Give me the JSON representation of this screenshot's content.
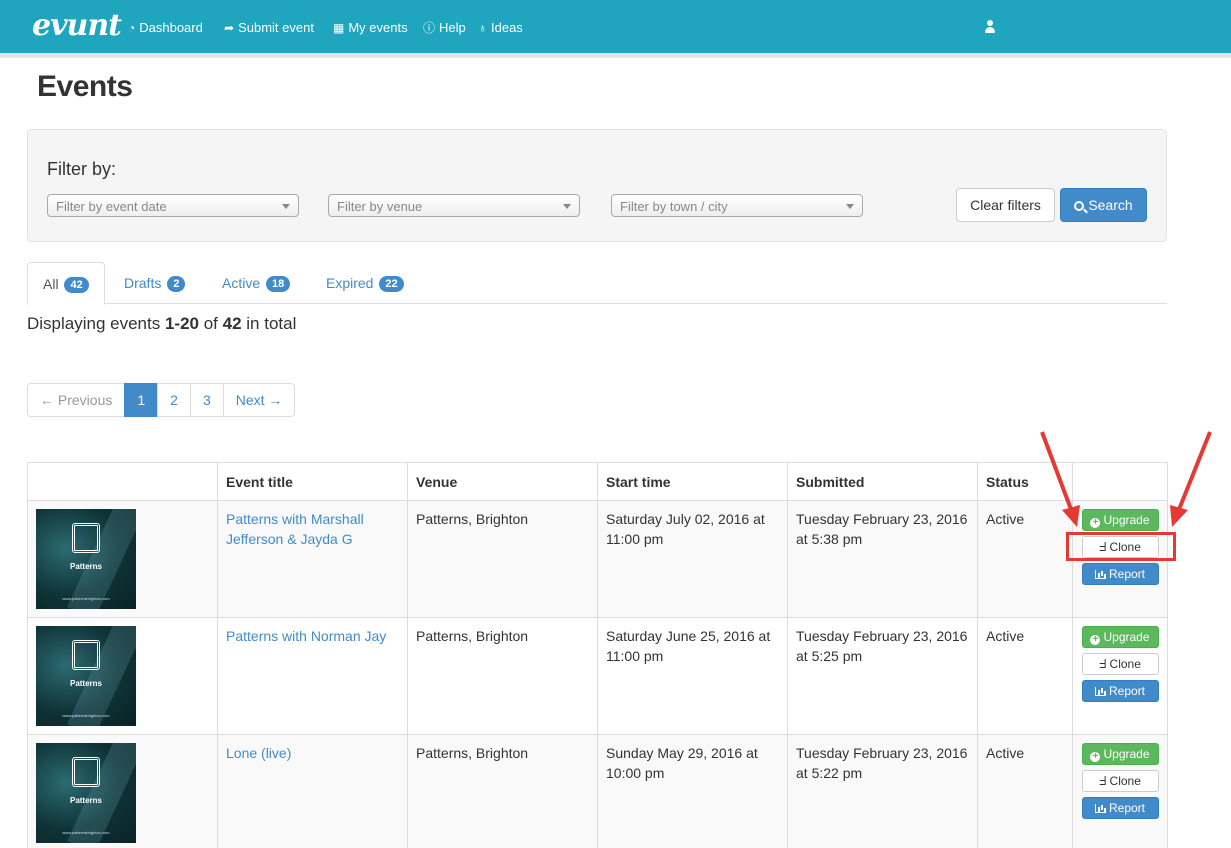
{
  "navbar": {
    "brand": "evunt",
    "items": [
      {
        "icon": "dashboard-icon",
        "glyph": "◔",
        "label": "Dashboard"
      },
      {
        "icon": "share-icon",
        "glyph": "➦",
        "label": "Submit event"
      },
      {
        "icon": "calendar-icon",
        "glyph": "▦",
        "label": "My events"
      },
      {
        "icon": "info-icon",
        "glyph": "ⓘ",
        "label": "Help"
      },
      {
        "icon": "lightbulb-icon",
        "glyph": "♁",
        "label": "Ideas"
      }
    ],
    "user_icon": "user-icon"
  },
  "page": {
    "title": "Events"
  },
  "filters": {
    "label": "Filter by:",
    "event_date_placeholder": "Filter by event date",
    "venue_placeholder": "Filter by venue",
    "town_placeholder": "Filter by town / city",
    "clear_label": "Clear filters",
    "search_label": "Search"
  },
  "tabs": [
    {
      "label": "All",
      "count": "42",
      "active": true
    },
    {
      "label": "Drafts",
      "count": "2"
    },
    {
      "label": "Active",
      "count": "18"
    },
    {
      "label": "Expired",
      "count": "22"
    }
  ],
  "summary": {
    "prefix": "Displaying events ",
    "range": "1-20",
    "middle": " of ",
    "total": "42",
    "suffix": " in total"
  },
  "pagination": {
    "prev": "← Previous",
    "pages": [
      "1",
      "2",
      "3"
    ],
    "current": "1",
    "next": "Next →"
  },
  "table": {
    "headers": [
      "",
      "Event title",
      "Venue",
      "Start time",
      "Submitted",
      "Status",
      ""
    ],
    "rows": [
      {
        "thumb_text": "Patterns",
        "thumb_url": "www.patternsbrighton.com",
        "title": "Patterns with Marshall Jefferson & Jayda G",
        "venue": "Patterns, Brighton",
        "start": "Saturday July 02, 2016 at 11:00 pm",
        "submitted": "Tuesday February 23, 2016 at 5:38 pm",
        "status": "Active"
      },
      {
        "thumb_text": "Patterns",
        "thumb_url": "www.patternsbrighton.com",
        "title": "Patterns with Norman Jay",
        "venue": "Patterns, Brighton",
        "start": "Saturday June 25, 2016 at 11:00 pm",
        "submitted": "Tuesday February 23, 2016 at 5:25 pm",
        "status": "Active"
      },
      {
        "thumb_text": "Patterns",
        "thumb_url": "www.patternsbrighton.com",
        "title": "Lone (live)",
        "venue": "Patterns, Brighton",
        "start": "Sunday May 29, 2016 at 10:00 pm",
        "submitted": "Tuesday February 23, 2016 at 5:22 pm",
        "status": "Active"
      }
    ],
    "actions": {
      "upgrade": "Upgrade",
      "clone": "Clone",
      "report": "Report"
    }
  },
  "colors": {
    "navbar": "#1fa5bd",
    "primary": "#428bca",
    "success": "#5cb85c",
    "annotation": "#e53935"
  }
}
